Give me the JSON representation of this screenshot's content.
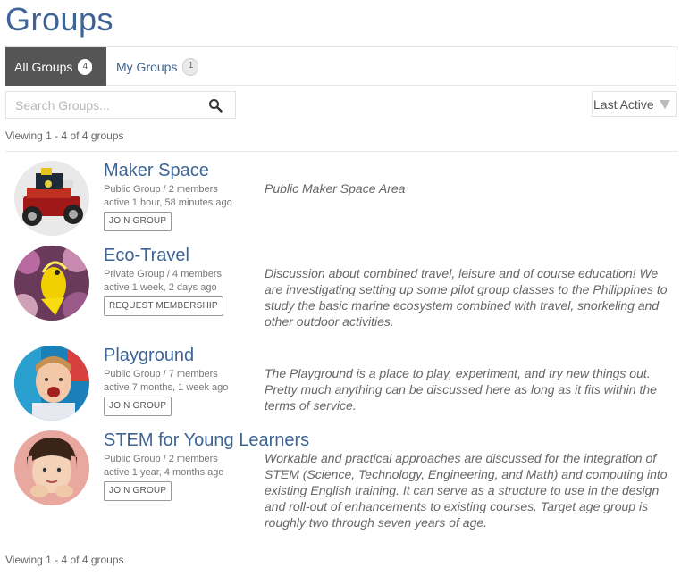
{
  "page": {
    "title": "Groups"
  },
  "tabs": [
    {
      "label": "All Groups",
      "count": "4"
    },
    {
      "label": "My Groups",
      "count": "1"
    }
  ],
  "search": {
    "placeholder": "Search Groups...",
    "value": ""
  },
  "sort": {
    "selected": "Last Active"
  },
  "viewing": {
    "top": "Viewing 1 - 4 of 4 groups",
    "bottom": "Viewing 1 - 4 of 4 groups"
  },
  "groups": [
    {
      "name": "Maker Space",
      "type": "Public Group / 2 members",
      "active": "active 1 hour, 58 minutes ago",
      "button": "JOIN GROUP",
      "description": "Public Maker Space Area"
    },
    {
      "name": "Eco-Travel",
      "type": "Private Group / 4 members",
      "active": "active 1 week, 2 days ago",
      "button": "REQUEST MEMBERSHIP",
      "description": "Discussion about combined travel, leisure and of course education! We are investigating setting up some pilot group classes to the Philippines to study the basic marine ecosystem combined with travel, snorkeling and other outdoor activities."
    },
    {
      "name": "Playground",
      "type": "Public Group / 7 members",
      "active": "active 7 months, 1 week ago",
      "button": "JOIN GROUP",
      "description": "The Playground is a place to play, experiment, and try new things out. Pretty much anything can be discussed here as long as it fits within the terms of service."
    },
    {
      "name": "STEM for Young Learners",
      "type": "Public Group / 2 members",
      "active": "active 1 year, 4 months ago",
      "button": "JOIN GROUP",
      "description": "Workable and practical approaches are discussed for the integration of STEM (Science, Technology, Engineering, and Math) and computing into existing English training. It can serve as a structure to use in the design and roll-out of enhancements to existing courses. Target age group is roughly two through seven years of age."
    }
  ]
}
